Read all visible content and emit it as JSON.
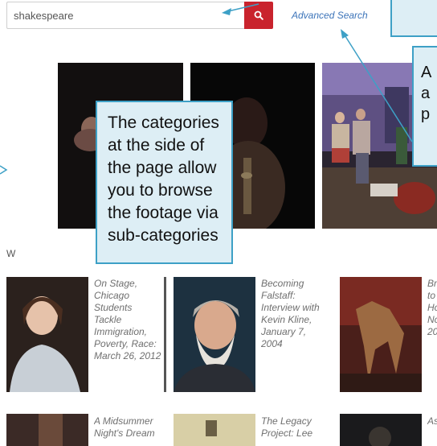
{
  "search": {
    "value": "shakespeare",
    "button_icon": "search-icon",
    "advanced_label": "Advanced Search"
  },
  "callouts": {
    "advanced_fragment": "A\na\np",
    "categories": "The categories at the side of the page allow you to browse the footage via sub-categories"
  },
  "section_fragment": "W",
  "results_row1": [
    {
      "title": "On Stage, Chicago Students Tackle Immigration, Poverty, Race: March 26, 2012"
    },
    {
      "title": "Becoming Falstaff: Interview with Kevin Kline, January 7, 2004"
    },
    {
      "title": "Br to Ho No 20"
    }
  ],
  "results_row2": [
    {
      "title": "A Midsummer Night's Dream"
    },
    {
      "title": "The Legacy Project: Lee"
    },
    {
      "title": "As"
    }
  ],
  "colors": {
    "search_button": "#c9232d",
    "link": "#3c74b9",
    "callout_fill": "#ddeef5",
    "callout_border": "#3da0c6"
  }
}
